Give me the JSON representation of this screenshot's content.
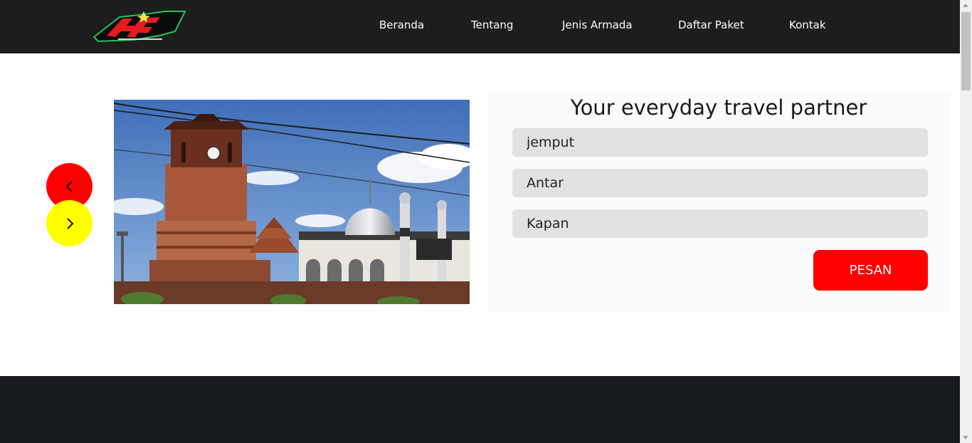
{
  "brand": {
    "logo_icon": "af-logo-icon"
  },
  "nav": {
    "items": [
      {
        "label": "Beranda"
      },
      {
        "label": "Tentang"
      },
      {
        "label": "Jenis Armada"
      },
      {
        "label": "Daftar Paket"
      },
      {
        "label": "Kontak"
      }
    ]
  },
  "slider": {
    "image_icon": "mosque-photo",
    "prev_icon": "chevron-left-icon",
    "next_icon": "chevron-right-icon"
  },
  "booking": {
    "title": "Your everyday travel partner",
    "pickup_placeholder": "jemput",
    "dropoff_placeholder": "Antar",
    "date_placeholder": "Kapan",
    "submit_label": "PESAN"
  },
  "colors": {
    "navbar": "#1d1d1d",
    "accent_red": "#ff0000",
    "accent_yellow": "#ffff00",
    "footer": "#181b1e"
  }
}
